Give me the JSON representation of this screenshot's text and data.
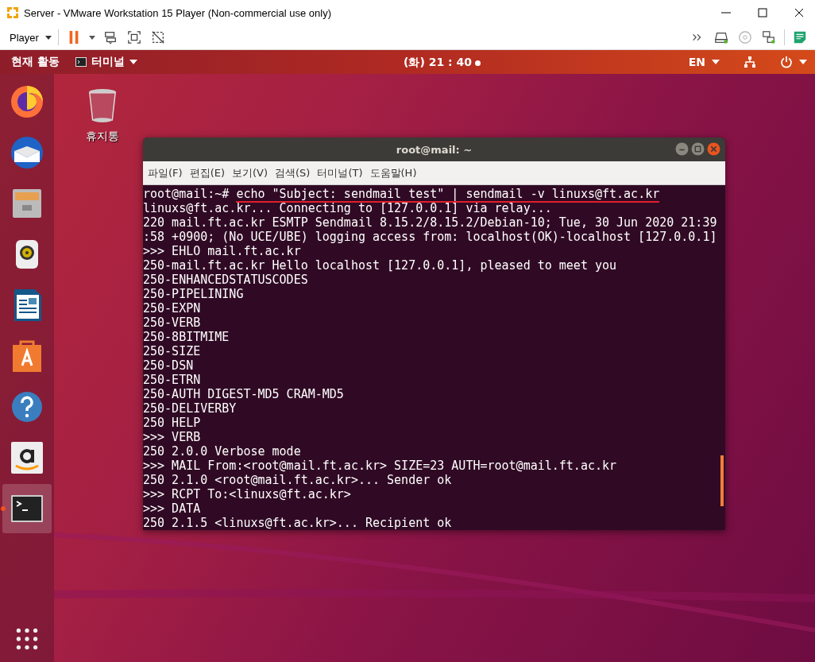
{
  "vm_window": {
    "title": "Server - VMware Workstation 15 Player (Non-commercial use only)",
    "player_menu": "Player"
  },
  "top_bar": {
    "activities": "현재 활동",
    "app_menu": "터미널",
    "clock": "(화) 21 : 40",
    "input_method": "EN"
  },
  "dock": {
    "items": [
      {
        "kind": "firefox",
        "selected": false,
        "running": false
      },
      {
        "kind": "thunderbird",
        "selected": false,
        "running": false
      },
      {
        "kind": "files",
        "selected": false,
        "running": false
      },
      {
        "kind": "music",
        "selected": false,
        "running": false
      },
      {
        "kind": "writer",
        "selected": false,
        "running": false
      },
      {
        "kind": "software",
        "selected": false,
        "running": false
      },
      {
        "kind": "help",
        "selected": false,
        "running": false
      },
      {
        "kind": "amazon",
        "selected": false,
        "running": false
      },
      {
        "kind": "terminal",
        "selected": true,
        "running": true
      }
    ]
  },
  "desktop_icons": [
    {
      "kind": "trash",
      "label": "휴지통"
    }
  ],
  "terminal": {
    "title": "root@mail: ~",
    "menu": [
      "파일(F)",
      "편집(E)",
      "보기(V)",
      "검색(S)",
      "터미널(T)",
      "도움말(H)"
    ],
    "prompt": "root@mail:~# ",
    "command": "echo \"Subject: sendmail test\" | sendmail -v linuxs@ft.ac.kr",
    "command_underlined": true,
    "lines": [
      "linuxs@ft.ac.kr... Connecting to [127.0.0.1] via relay...",
      "220 mail.ft.ac.kr ESMTP Sendmail 8.15.2/8.15.2/Debian-10; Tue, 30 Jun 2020 21:39",
      ":58 +0900; (No UCE/UBE) logging access from: localhost(OK)-localhost [127.0.0.1]",
      ">>> EHLO mail.ft.ac.kr",
      "250-mail.ft.ac.kr Hello localhost [127.0.0.1], pleased to meet you",
      "250-ENHANCEDSTATUSCODES",
      "250-PIPELINING",
      "250-EXPN",
      "250-VERB",
      "250-8BITMIME",
      "250-SIZE",
      "250-DSN",
      "250-ETRN",
      "250-AUTH DIGEST-MD5 CRAM-MD5",
      "250-DELIVERBY",
      "250 HELP",
      ">>> VERB",
      "250 2.0.0 Verbose mode",
      ">>> MAIL From:<root@mail.ft.ac.kr> SIZE=23 AUTH=root@mail.ft.ac.kr",
      "250 2.1.0 <root@mail.ft.ac.kr>... Sender ok",
      ">>> RCPT To:<linuxs@ft.ac.kr>",
      ">>> DATA",
      "250 2.1.5 <linuxs@ft.ac.kr>... Recipient ok"
    ]
  }
}
